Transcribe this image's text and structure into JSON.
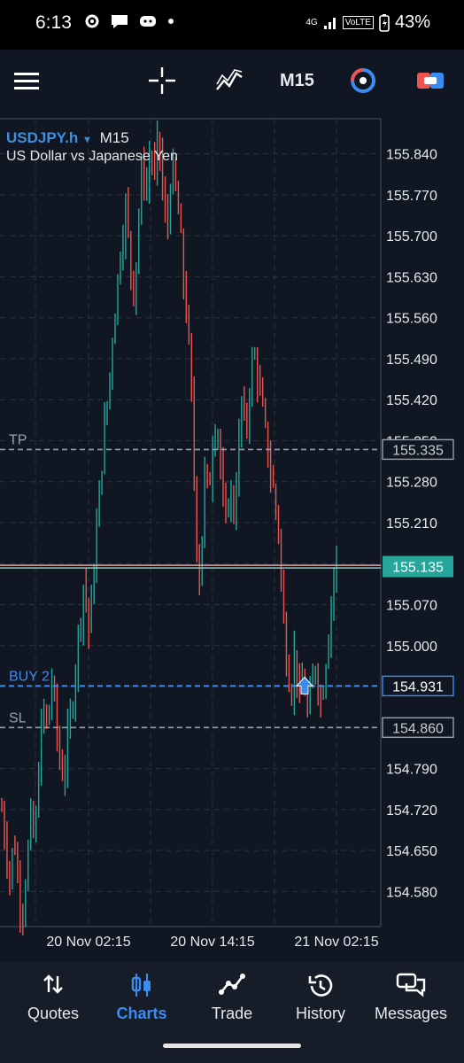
{
  "status": {
    "time": "6:13",
    "net": "4G",
    "volte": "VoLTE",
    "battery": "43%"
  },
  "toolbar": {
    "timeframe": "M15"
  },
  "symbol": {
    "name": "USDJPY.h",
    "timeframe": "M15",
    "description": "US Dollar vs Japanese Yen"
  },
  "colors": {
    "bull": "#26a69a",
    "bear": "#ef5350",
    "grid": "#2b3340",
    "accent": "#3b8cf0",
    "price_bg": "#26a69a"
  },
  "chart_data": {
    "type": "candlestick",
    "ylim": [
      154.52,
      155.9
    ],
    "y_ticks": [
      "155.840",
      "155.770",
      "155.700",
      "155.630",
      "155.560",
      "155.490",
      "155.420",
      "155.350",
      "155.280",
      "155.210",
      "155.140",
      "155.070",
      "155.000",
      "154.930",
      "154.860",
      "154.790",
      "154.720",
      "154.650",
      "154.580"
    ],
    "x_ticks": [
      "20 Nov 02:15",
      "20 Nov 14:15",
      "21 Nov 02:15"
    ],
    "levels": [
      {
        "label": "TP",
        "price": "155.335",
        "value": 155.335
      },
      {
        "label": "BUY 2",
        "price": "154.931",
        "value": 154.931
      },
      {
        "label": "SL",
        "price": "154.860",
        "value": 154.86
      }
    ],
    "current_price": {
      "price": "155.135",
      "value": 155.135
    },
    "path": [
      154.72,
      154.66,
      154.6,
      154.68,
      154.58,
      154.55,
      154.62,
      154.7,
      154.66,
      154.8,
      154.9,
      154.85,
      154.95,
      154.88,
      154.8,
      154.78,
      154.84,
      154.9,
      154.98,
      155.05,
      155.12,
      155.02,
      155.1,
      155.2,
      155.3,
      155.38,
      155.45,
      155.55,
      155.62,
      155.7,
      155.75,
      155.66,
      155.6,
      155.72,
      155.82,
      155.78,
      155.85,
      155.8,
      155.88,
      155.76,
      155.7,
      155.82,
      155.78,
      155.72,
      155.62,
      155.55,
      155.4,
      155.2,
      155.1,
      155.3,
      155.25,
      155.35,
      155.4,
      155.3,
      155.18,
      155.28,
      155.22,
      155.3,
      155.42,
      155.35,
      155.45,
      155.5,
      155.46,
      155.4,
      155.35,
      155.3,
      155.25,
      155.2,
      155.05,
      154.98,
      154.92,
      155.0,
      154.9,
      154.95,
      154.88,
      154.92,
      154.98,
      154.9,
      154.95,
      155.02,
      155.1,
      155.15
    ]
  },
  "nav": [
    {
      "label": "Quotes",
      "icon": "sort-arrows-icon"
    },
    {
      "label": "Charts",
      "icon": "candles-icon"
    },
    {
      "label": "Trade",
      "icon": "trade-line-icon"
    },
    {
      "label": "History",
      "icon": "history-clock-icon"
    },
    {
      "label": "Messages",
      "icon": "messages-icon"
    }
  ]
}
